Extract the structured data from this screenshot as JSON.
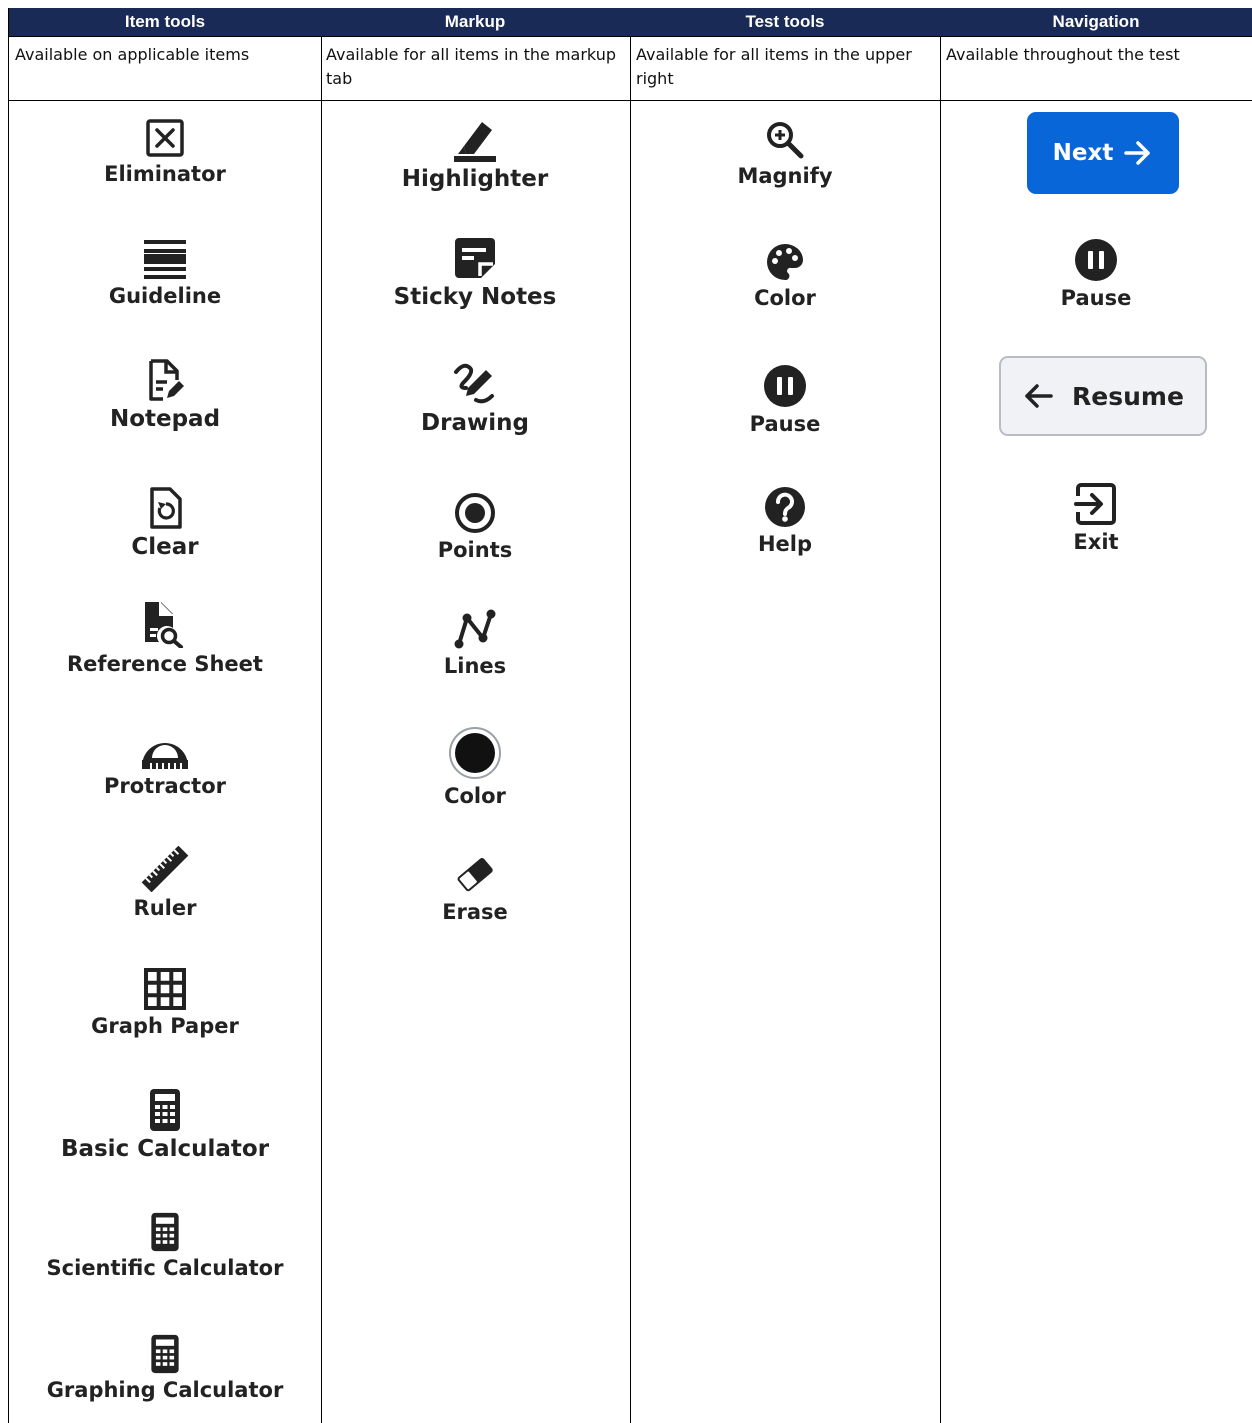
{
  "columns": [
    {
      "header": "Item tools",
      "description": "Available on applicable items",
      "tools": [
        "Eliminator",
        "Guideline",
        "Notepad",
        "Clear",
        "Reference Sheet",
        "Protractor",
        "Ruler",
        "Graph Paper",
        "Basic Calculator",
        "Scientific Calculator",
        "Graphing Calculator"
      ]
    },
    {
      "header": "Markup",
      "description": "Available for all items in the markup tab",
      "tools": [
        "Highlighter",
        "Sticky Notes",
        "Drawing",
        "Points",
        "Lines",
        "Color",
        "Erase"
      ]
    },
    {
      "header": "Test tools",
      "description": "Available for all items in the upper right",
      "tools": [
        "Magnify",
        "Color",
        "Pause",
        "Help"
      ]
    },
    {
      "header": "Navigation",
      "description": "Available throughout the test",
      "buttons": {
        "next": "Next",
        "resume": "Resume"
      },
      "tools": [
        "Pause",
        "Exit"
      ]
    }
  ],
  "colors": {
    "header_bg": "#1a2a57",
    "next_button": "#0866d8",
    "icon": "#222222"
  },
  "icons": [
    "close-box-icon",
    "guideline-icon",
    "notepad-icon",
    "clear-icon",
    "reference-sheet-icon",
    "protractor-icon",
    "ruler-icon",
    "graph-paper-icon",
    "calculator-icon",
    "highlighter-icon",
    "sticky-note-icon",
    "drawing-icon",
    "points-icon",
    "lines-icon",
    "color-dot-icon",
    "eraser-icon",
    "magnify-icon",
    "palette-icon",
    "pause-icon",
    "help-icon",
    "arrow-right-icon",
    "arrow-left-icon",
    "exit-icon"
  ]
}
